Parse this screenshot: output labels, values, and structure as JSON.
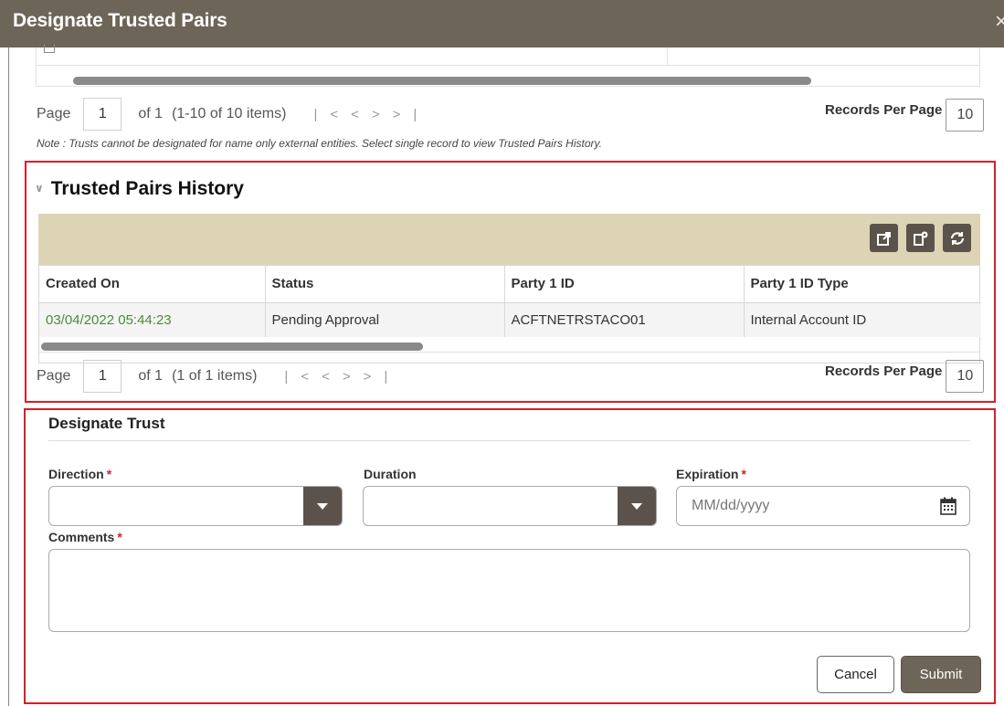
{
  "dialog": {
    "title": "Designate Trusted Pairs",
    "close_glyph": "×"
  },
  "top_pager": {
    "page_label": "Page",
    "page_value": "1",
    "of_text": "of 1",
    "items_text": "(1-10 of 10 items)",
    "records_per_page_label": "Records Per Page",
    "records_per_page_value": "10"
  },
  "note": "Note : Trusts cannot be designated for name only external entities. Select single record to view Trusted Pairs History.",
  "history": {
    "title": "Trusted Pairs History",
    "toolbar_icons": [
      "export-icon",
      "columns-settings-icon",
      "refresh-icon"
    ],
    "columns": [
      "Created On",
      "Status",
      "Party 1 ID",
      "Party 1 ID Type"
    ],
    "rows": [
      [
        "03/04/2022 05:44:23",
        "Pending Approval",
        "ACFTNETRSTACO01",
        "Internal Account ID"
      ]
    ],
    "pager": {
      "page_label": "Page",
      "page_value": "1",
      "of_text": "of 1",
      "items_text": "(1 of 1 items)",
      "records_per_page_label": "Records Per Page",
      "records_per_page_value": "10"
    }
  },
  "designate_trust": {
    "title": "Designate Trust",
    "direction_label": "Direction",
    "duration_label": "Duration",
    "expiration_label": "Expiration",
    "expiration_placeholder": "MM/dd/yyyy",
    "comments_label": "Comments",
    "required_marker": "*",
    "cancel_label": "Cancel",
    "submit_label": "Submit"
  },
  "colors": {
    "title_bar": "#6e6559",
    "highlight_border": "#d4202a",
    "toolbar_bg": "#ddd4b6",
    "link_green": "#4d8a3d"
  }
}
